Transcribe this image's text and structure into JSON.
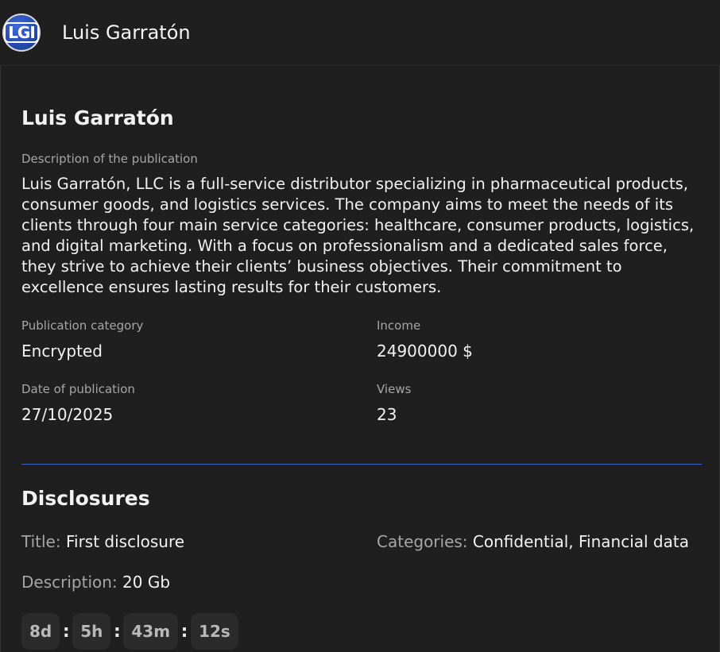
{
  "header": {
    "logo_text": "LGI",
    "title": "Luis Garratón"
  },
  "publication": {
    "title": "Luis Garratón",
    "description_label": "Description of the publication",
    "description": "Luis Garratón, LLC is a full-service distributor specializing in pharmaceutical products, consumer goods, and logistics services. The company aims to meet the needs of its clients through four main service categories: healthcare, consumer products, logistics, and digital marketing. With a focus on professionalism and a dedicated sales force, they strive to achieve their clients’ business objectives. Their commitment to excellence ensures lasting results for their customers.",
    "category_label": "Publication category",
    "category": "Encrypted",
    "income_label": "Income",
    "income": "24900000 $",
    "date_label": "Date of publication",
    "date": "27/10/2025",
    "views_label": "Views",
    "views": "23"
  },
  "disclosures": {
    "heading": "Disclosures",
    "title_key": "Title:",
    "title_value": "First disclosure",
    "categories_key": "Categories:",
    "categories_value": "Confidential, Financial data",
    "description_key": "Description:",
    "description_value": "20 Gb",
    "countdown": {
      "days": "8d",
      "hours": "5h",
      "minutes": "43m",
      "seconds": "12s",
      "separator": ":"
    }
  },
  "colors": {
    "background": "#1f1f1f",
    "accent": "#3d63c8",
    "logo": "#2347a8"
  }
}
